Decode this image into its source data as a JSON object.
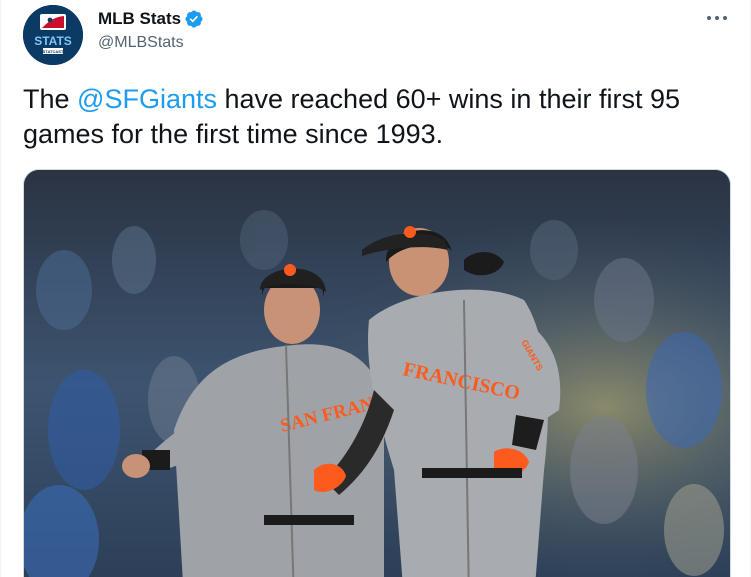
{
  "account": {
    "display_name": "MLB Stats",
    "handle": "@MLBStats",
    "avatar_text": "STATS",
    "avatar_subtext": "STATCAST"
  },
  "tweet": {
    "text_before": "The ",
    "mention": "@SFGiants",
    "text_after": " have reached 60+ wins in their first 95 games for the first time since 1993."
  },
  "photo": {
    "jersey_left": "SAN FRANCISCO",
    "jersey_right": "FRANCISCO",
    "sleeve_patch": "GIANTS"
  },
  "icons": {
    "verified": "verified-badge-icon",
    "more": "more-options-icon"
  },
  "colors": {
    "accent": "#1d9bf0",
    "giants_orange": "#fd5a1e",
    "avatar_navy": "#0b3a64"
  }
}
